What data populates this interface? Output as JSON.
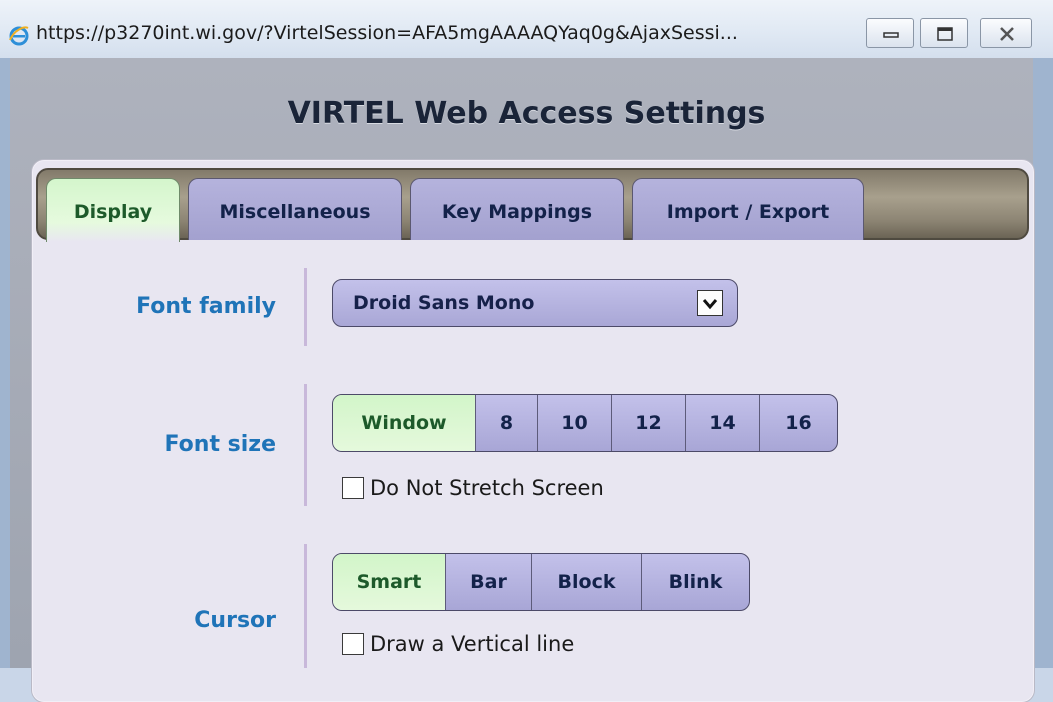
{
  "window": {
    "url_title": "https://p3270int.wi.gov/?VirtelSession=AFA5mgAAAAQYaq0g&AjaxSessi...",
    "logo_icon": "internet-explorer-icon",
    "controls": [
      "minimize-icon",
      "restore-icon",
      "close-icon"
    ]
  },
  "page": {
    "title": "VIRTEL Web Access Settings"
  },
  "tabs": [
    {
      "label": "Display",
      "active": true
    },
    {
      "label": "Miscellaneous",
      "active": false
    },
    {
      "label": "Key Mappings",
      "active": false
    },
    {
      "label": "Import / Export",
      "active": false
    }
  ],
  "settings": {
    "font_family": {
      "label": "Font family",
      "selected": "Droid Sans Mono"
    },
    "font_size": {
      "label": "Font size",
      "options": [
        "Window",
        "8",
        "10",
        "12",
        "14",
        "16"
      ],
      "selected": "Window",
      "checkbox_label": "Do Not Stretch Screen",
      "checkbox_checked": false
    },
    "cursor": {
      "label": "Cursor",
      "options": [
        "Smart",
        "Bar",
        "Block",
        "Blink"
      ],
      "selected": "Smart",
      "checkbox_label": "Draw a Vertical line",
      "checkbox_checked": false
    }
  },
  "colors": {
    "active_tab": "#d4f6cc",
    "inactive_tab": "#b5b3dd",
    "label_blue": "#1f74b8"
  }
}
